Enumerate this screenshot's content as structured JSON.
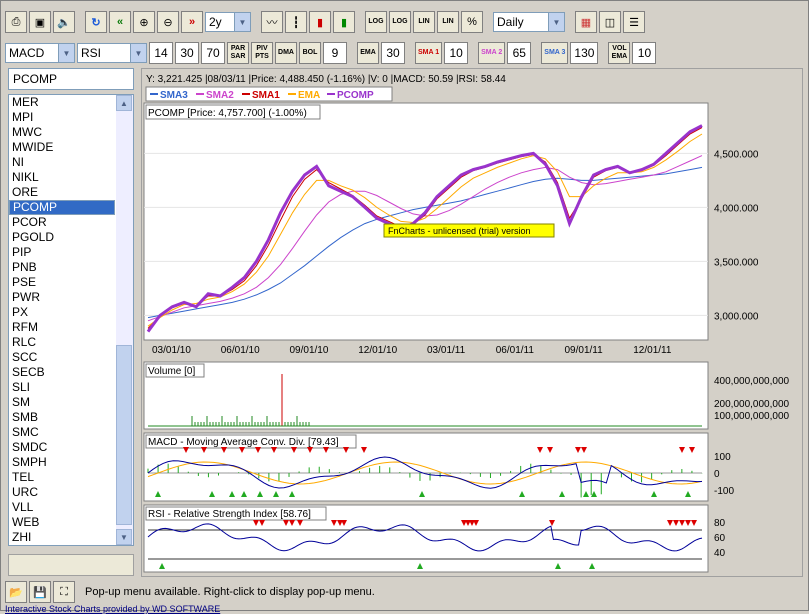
{
  "toolbar1": {
    "period": "2y",
    "interval": "Daily",
    "log1": "LOG",
    "log2": "LOG",
    "lin1": "LIN",
    "lin2": "LIN",
    "pct": "%"
  },
  "toolbar2": {
    "ind1": "MACD",
    "ind2": "RSI",
    "macd_fast": "14",
    "macd_slow": "30",
    "macd_sig": "70",
    "par_sar": "PAR SAR",
    "piv_pts": "PIV PTS",
    "dma": "DMA",
    "bol": "BOL",
    "bol_val": "9",
    "ema": "EMA",
    "ema_val": "30",
    "sma1": "SMA 1",
    "sma1_val": "10",
    "sma2": "SMA 2",
    "sma2_val": "65",
    "sma3": "SMA 3",
    "sma3_val": "130",
    "vol_ema": "VOL EMA",
    "vol_ema_val": "10"
  },
  "symbol": "PCOMP",
  "symbols": [
    "MER",
    "MPI",
    "MWC",
    "MWIDE",
    "NI",
    "NIKL",
    "ORE",
    "PCOMP",
    "PCOR",
    "PGOLD",
    "PIP",
    "PNB",
    "PSE",
    "PWR",
    "PX",
    "RFM",
    "RLC",
    "SCC",
    "SECB",
    "SLI",
    "SM",
    "SMB",
    "SMC",
    "SMDC",
    "SMPH",
    "TEL",
    "URC",
    "VLL",
    "WEB",
    "ZHI"
  ],
  "selected_symbol": "PCOMP",
  "info_line": "Y: 3,221.425 |08/03/11 |Price: 4,488.450 (-1.16%) |V: 0 |MACD: 50.59 |RSI: 58.44",
  "legend": [
    {
      "name": "SMA3",
      "color": "#3366cc"
    },
    {
      "name": "SMA2",
      "color": "#cc44cc"
    },
    {
      "name": "SMA1",
      "color": "#cc0000"
    },
    {
      "name": "EMA",
      "color": "#ffaa00"
    },
    {
      "name": "PCOMP",
      "color": "#9933cc"
    }
  ],
  "price_label": "PCOMP [Price: 4,757.700] (-1.00%)",
  "watermark": "FnCharts - unlicensed (trial) version",
  "volume_label": "Volume [0]",
  "macd_label": "MACD - Moving Average Conv. Div. [79.43]",
  "rsi_label": "RSI - Relative Strength Index [58.76]",
  "status_message": "Pop-up menu available. Right-click to display pop-up menu.",
  "footer": "Interactive Stock Charts provided by WD SOFTWARE",
  "chart_data": [
    {
      "type": "line",
      "title": "PCOMP [Price: 4,757.700] (-1.00%)",
      "x_ticks": [
        "03/01/10",
        "06/01/10",
        "09/01/10",
        "12/01/10",
        "03/01/11",
        "06/01/11",
        "09/01/11",
        "12/01/11"
      ],
      "y_ticks": [
        "3,000.000",
        "3,500.000",
        "4,000.000",
        "4,500.000"
      ],
      "ylim": [
        2800,
        4800
      ],
      "series": [
        {
          "name": "PCOMP",
          "values": [
            2850,
            3000,
            3080,
            3120,
            3080,
            3200,
            3180,
            3260,
            3350,
            3500,
            3700,
            3950,
            4150,
            4300,
            4380,
            4200,
            4150,
            4100,
            4000,
            3900,
            3850,
            3800,
            3850,
            3950,
            4100,
            4200,
            4300,
            4350,
            4380,
            4420,
            4450,
            4480,
            4500,
            4400,
            4200,
            3850,
            4100,
            4300,
            4350,
            4380,
            4320,
            4350,
            4400,
            4500,
            4600,
            4700,
            4757
          ]
        },
        {
          "name": "EMA",
          "values": [
            2900,
            2980,
            3050,
            3100,
            3110,
            3150,
            3170,
            3220,
            3290,
            3400,
            3550,
            3750,
            3950,
            4120,
            4250,
            4250,
            4200,
            4160,
            4090,
            4000,
            3930,
            3870,
            3860,
            3900,
            3990,
            4090,
            4190,
            4270,
            4320,
            4370,
            4410,
            4450,
            4480,
            4450,
            4330,
            4100,
            4100,
            4200,
            4270,
            4320,
            4320,
            4330,
            4370,
            4440,
            4520,
            4610,
            4680
          ]
        },
        {
          "name": "SMA1",
          "values": [
            2880,
            2990,
            3070,
            3110,
            3090,
            3180,
            3180,
            3240,
            3320,
            3460,
            3650,
            3880,
            4100,
            4260,
            4350,
            4230,
            4170,
            4110,
            4020,
            3920,
            3870,
            3820,
            3840,
            3930,
            4080,
            4180,
            4280,
            4340,
            4370,
            4410,
            4440,
            4470,
            4490,
            4420,
            4230,
            3900,
            4080,
            4280,
            4340,
            4370,
            4320,
            4340,
            4390,
            4480,
            4580,
            4680,
            4740
          ]
        },
        {
          "name": "SMA2",
          "values": [
            2950,
            2990,
            3030,
            3070,
            3090,
            3110,
            3130,
            3160,
            3200,
            3260,
            3350,
            3470,
            3620,
            3780,
            3930,
            4050,
            4120,
            4150,
            4150,
            4110,
            4050,
            3990,
            3940,
            3920,
            3930,
            3970,
            4030,
            4100,
            4170,
            4230,
            4280,
            4320,
            4350,
            4370,
            4350,
            4280,
            4230,
            4210,
            4220,
            4240,
            4260,
            4280,
            4300,
            4330,
            4380,
            4430,
            4480
          ]
        },
        {
          "name": "SMA3",
          "values": [
            2980,
            3000,
            3020,
            3040,
            3060,
            3080,
            3100,
            3120,
            3150,
            3190,
            3240,
            3300,
            3380,
            3460,
            3550,
            3640,
            3720,
            3790,
            3850,
            3890,
            3920,
            3950,
            3980,
            4000,
            4020,
            4040,
            4060,
            4090,
            4120,
            4150,
            4180,
            4210,
            4240,
            4260,
            4270,
            4260,
            4250,
            4250,
            4260,
            4270,
            4280,
            4290,
            4300,
            4310,
            4330,
            4350,
            4370
          ]
        }
      ]
    },
    {
      "type": "bar",
      "title": "Volume [0]",
      "y_ticks": [
        "100,000,000,000",
        "200,000,000,000",
        "400,000,000,000"
      ]
    },
    {
      "type": "line",
      "title": "MACD - Moving Average Conv. Div. [79.43]",
      "y_ticks": [
        "100",
        "0",
        "-100"
      ]
    },
    {
      "type": "line",
      "title": "RSI - Relative Strength Index [58.76]",
      "y_ticks": [
        "80",
        "60",
        "40"
      ]
    }
  ]
}
